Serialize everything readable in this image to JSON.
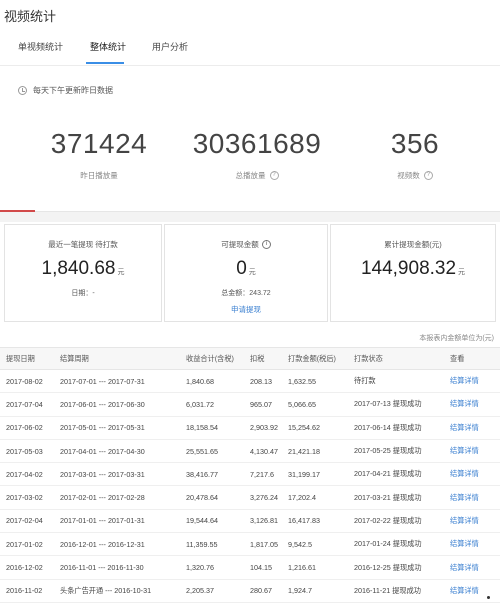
{
  "header": {
    "title": "视频统计"
  },
  "tabs": [
    {
      "label": "单视频统计"
    },
    {
      "label": "整体统计"
    },
    {
      "label": "用户分析"
    }
  ],
  "notice": "每天下午更新昨日数据",
  "stats": [
    {
      "value": "371424",
      "label": "昨日播放量"
    },
    {
      "value": "30361689",
      "label": "总播放量"
    },
    {
      "value": "356",
      "label": "视频数"
    }
  ],
  "cards": {
    "recent": {
      "title": "最近一笔提现 待打款",
      "amount": "1,840.68",
      "unit": "元",
      "sub": "日期：-"
    },
    "withdrawable": {
      "title": "可提现金额",
      "amount": "0",
      "unit": "元",
      "sub": "总金额：243.72",
      "link": "申请提现"
    },
    "total": {
      "title": "累计提现金额(元)",
      "amount": "144,908.32",
      "unit": "元"
    }
  },
  "unit_note": "本报表内金额单位为(元)",
  "table": {
    "headers": [
      "提现日期",
      "结算周期",
      "收益合计(含税)",
      "扣税",
      "打款金额(税后)",
      "打款状态",
      "查看"
    ],
    "rows": [
      [
        "2017-08-02",
        "2017-07-01 --- 2017-07-31",
        "1,840.68",
        "208.13",
        "1,632.55",
        "待打款",
        "结算详情"
      ],
      [
        "2017-07-04",
        "2017-06-01 --- 2017-06-30",
        "6,031.72",
        "965.07",
        "5,066.65",
        "2017-07-13 提现成功",
        "结算详情"
      ],
      [
        "2017-06-02",
        "2017-05-01 --- 2017-05-31",
        "18,158.54",
        "2,903.92",
        "15,254.62",
        "2017-06-14 提现成功",
        "结算详情"
      ],
      [
        "2017-05-03",
        "2017-04-01 --- 2017-04-30",
        "25,551.65",
        "4,130.47",
        "21,421.18",
        "2017-05-25 提现成功",
        "结算详情"
      ],
      [
        "2017-04-02",
        "2017-03-01 --- 2017-03-31",
        "38,416.77",
        "7,217.6",
        "31,199.17",
        "2017-04-21 提现成功",
        "结算详情"
      ],
      [
        "2017-03-02",
        "2017-02-01 --- 2017-02-28",
        "20,478.64",
        "3,276.24",
        "17,202.4",
        "2017-03-21 提现成功",
        "结算详情"
      ],
      [
        "2017-02-04",
        "2017-01-01 --- 2017-01-31",
        "19,544.64",
        "3,126.81",
        "16,417.83",
        "2017-02-22 提现成功",
        "结算详情"
      ],
      [
        "2017-01-02",
        "2016-12-01 --- 2016-12-31",
        "11,359.55",
        "1,817.05",
        "9,542.5",
        "2017-01-24 提现成功",
        "结算详情"
      ],
      [
        "2016-12-02",
        "2016-11-01 --- 2016-11-30",
        "1,320.76",
        "104.15",
        "1,216.61",
        "2016-12-25 提现成功",
        "结算详情"
      ],
      [
        "2016-11-02",
        "头条广告开通 --- 2016-10-31",
        "2,205.37",
        "280.67",
        "1,924.7",
        "2016-11-21 提现成功",
        "结算详情"
      ]
    ]
  }
}
